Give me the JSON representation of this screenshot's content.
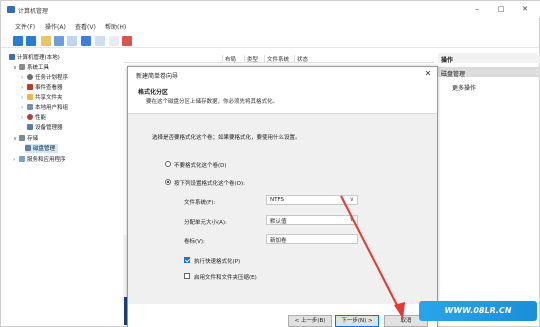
{
  "window": {
    "title": "计算机管理",
    "menu": [
      "文件(F)",
      "操作(A)",
      "查看(V)",
      "帮助(H)"
    ]
  },
  "tree": {
    "items": [
      {
        "label": "计算机管理(本地)"
      },
      {
        "label": "系统工具"
      },
      {
        "label": "任务计划程序"
      },
      {
        "label": "事件查看器"
      },
      {
        "label": "共享文件夹"
      },
      {
        "label": "本地用户和组"
      },
      {
        "label": "性能"
      },
      {
        "label": "设备管理器"
      },
      {
        "label": "存储"
      },
      {
        "label": "磁盘管理"
      },
      {
        "label": "服务和应用程序"
      }
    ]
  },
  "columns": [
    "布局",
    "类型",
    "文件系统",
    "状态"
  ],
  "actions": {
    "header": "操作",
    "section": "磁盘管理",
    "more": "更多操作"
  },
  "dialog": {
    "title": "新建简单卷向导",
    "heading": "格式化分区",
    "subheading": "要在这个磁盘分区上储存数据，你必须先将其格式化。",
    "prompt": "选择是否要格式化这个卷；如果要格式化，要使用什么设置。",
    "radio_no": "不要格式化这个卷(D)",
    "radio_yes": "按下列设置格式化这个卷(O):",
    "fs_label": "文件系统(F):",
    "fs_value": "NTFS",
    "alloc_label": "分配单元大小(A):",
    "alloc_value": "默认值",
    "vol_label": "卷标(V):",
    "vol_value": "新加卷",
    "quick_format": "执行快速格式化(P)",
    "compress": "启用文件和文件夹压缩(E)",
    "back": "< 上一步(B)",
    "next": "下一步(N) >",
    "cancel": "取消"
  },
  "watermark": "WWW.08LR.CN",
  "colors": {
    "selection": "#cde8ff",
    "accent": "#0078d7",
    "arrow": "#e53935"
  }
}
